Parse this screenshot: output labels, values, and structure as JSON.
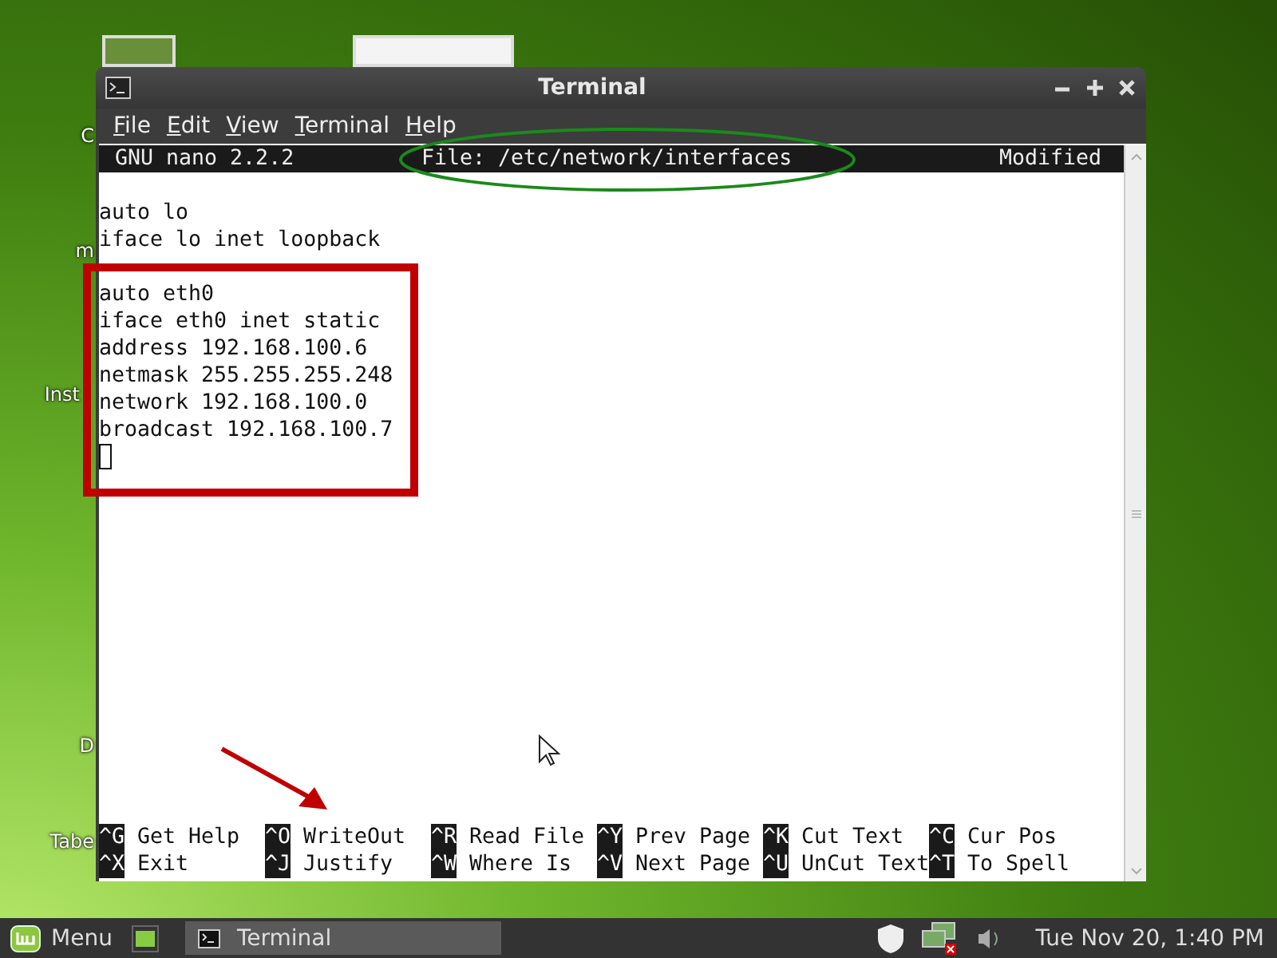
{
  "desktop_labels": [
    "C",
    "m",
    "Inst",
    "D",
    "Tabe"
  ],
  "window": {
    "title": "Terminal"
  },
  "menu": [
    "File",
    "Edit",
    "View",
    "Terminal",
    "Help"
  ],
  "nano": {
    "version": "GNU nano 2.2.2",
    "file": "File: /etc/network/interfaces",
    "status": "Modified"
  },
  "blocks": [
    [
      "auto lo",
      "iface lo inet loopback"
    ],
    [
      "auto eth0",
      "iface eth0 inet static",
      "address 192.168.100.6",
      "netmask 255.255.255.248",
      "network 192.168.100.0",
      "broadcast 192.168.100.7"
    ]
  ],
  "shortcut_rows": [
    [
      {
        "key": "^G",
        "label": "Get Help"
      },
      {
        "key": "^O",
        "label": "WriteOut"
      },
      {
        "key": "^R",
        "label": "Read File"
      },
      {
        "key": "^Y",
        "label": "Prev Page"
      },
      {
        "key": "^K",
        "label": "Cut Text"
      },
      {
        "key": "^C",
        "label": "Cur Pos"
      }
    ],
    [
      {
        "key": "^X",
        "label": "Exit"
      },
      {
        "key": "^J",
        "label": "Justify"
      },
      {
        "key": "^W",
        "label": "Where Is"
      },
      {
        "key": "^V",
        "label": "Next Page"
      },
      {
        "key": "^U",
        "label": "UnCut Text"
      },
      {
        "key": "^T",
        "label": "To Spell"
      }
    ]
  ],
  "taskbar": {
    "menu_label": "Menu",
    "tasks": [
      "Terminal"
    ],
    "clock": "Tue Nov 20, 1:40 PM"
  }
}
